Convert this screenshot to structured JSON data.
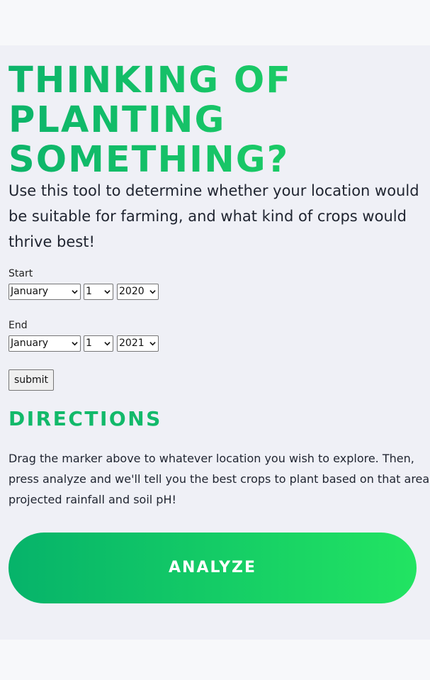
{
  "hero": {
    "headline": "THINKING OF PLANTING SOMETHING?",
    "intro": "Use this tool to determine whether your location would be suitable for farming, and what kind of crops would thrive best!"
  },
  "form": {
    "start": {
      "label": "Start",
      "month": "January",
      "day": "1",
      "year": "2020"
    },
    "end": {
      "label": "End",
      "month": "January",
      "day": "1",
      "year": "2021"
    },
    "submit_label": "submit"
  },
  "directions": {
    "title": "DIRECTIONS",
    "text": "Drag the marker above to whatever location you wish to explore. Then, press analyze and we'll tell you the best crops to plant based on that area's projected rainfall and soil pH!"
  },
  "analyze_label": "ANALYZE",
  "colors": {
    "accent_start": "#06b36a",
    "accent_end": "#22e462",
    "panel_bg": "#eff0f6",
    "page_bg": "#f7f8fa"
  },
  "icons": {
    "select_arrow": "chevron-down-icon"
  }
}
